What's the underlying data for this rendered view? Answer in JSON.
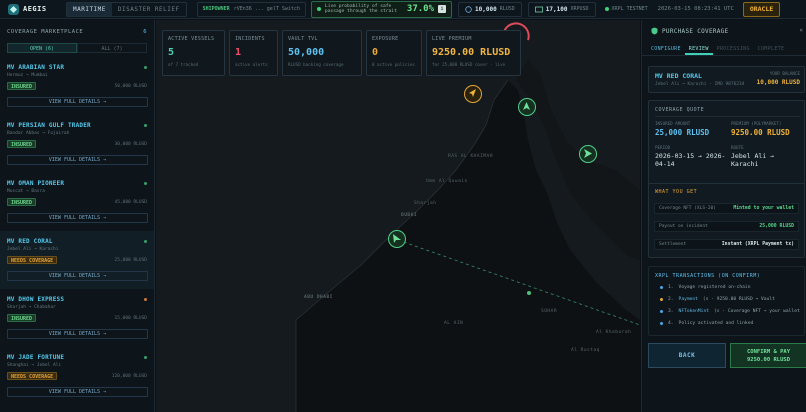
{
  "app": {
    "name": "AEGIS",
    "modes": [
      "MARITIME",
      "DISASTER RELIEF"
    ],
    "active_mode": "MARITIME"
  },
  "topbar": {
    "role_label": "SHIPOWNER",
    "role_detail": "rVEn36 ... gelT  Switch",
    "prob_text": "Live probability of safe passage through the strait",
    "prob_value": "37.0%",
    "prob_icon": "i",
    "rlusd_balance": "10,000",
    "rlusd_unit": "RLUSD",
    "xrp_balance": "17,100",
    "xrp_unit": "XRPUSD",
    "network": "XRPL TESTNET",
    "timestamp": "2026-03-15 08:23:41 UTC",
    "oracle_label": "ORACLE"
  },
  "left": {
    "title": "COVERAGE MARKETPLACE",
    "count": "6",
    "tabs": [
      {
        "label": "OPEN (6)"
      },
      {
        "label": "ALL (7)"
      }
    ],
    "vessels": [
      {
        "name": "MV ARABIAN STAR",
        "route": "Hormuz → Mumbai",
        "status": "INSURED",
        "amount": "50,000 RLUSD",
        "action": "VIEW FULL DETAILS →",
        "dot": "#3aa06a"
      },
      {
        "name": "MV PERSIAN GULF TRADER",
        "route": "Bandar Abbas → Fujairah",
        "status": "INSURED",
        "amount": "30,000 RLUSD",
        "action": "VIEW FULL DETAILS →",
        "dot": "#3aa06a"
      },
      {
        "name": "MV OMAN PIONEER",
        "route": "Muscat → Basra",
        "status": "INSURED",
        "amount": "45,000 RLUSD",
        "action": "VIEW FULL DETAILS →",
        "dot": "#3aa06a"
      },
      {
        "name": "MV RED CORAL",
        "route": "Jebel Ali → Karachi",
        "status": "NEEDS COVERAGE",
        "amount": "25,000 RLUSD",
        "action": "VIEW FULL DETAILS →",
        "dot": "#3aa06a"
      },
      {
        "name": "MV DHOW EXPRESS",
        "route": "Sharjah → Chabahar",
        "status": "INSURED",
        "amount": "15,000 RLUSD",
        "action": "VIEW FULL DETAILS →",
        "dot": "#d07a3a"
      },
      {
        "name": "MV JADE FORTUNE",
        "route": "Shanghai → Jebel Ali",
        "status": "NEEDS COVERAGE",
        "amount": "120,000 RLUSD",
        "action": "VIEW FULL DETAILS →",
        "dot": "#3aa06a"
      }
    ]
  },
  "stats": [
    {
      "label": "ACTIVE VESSELS",
      "value": "5",
      "sub": "of 7 tracked",
      "color": "#4fd0b0"
    },
    {
      "label": "INCIDENTS",
      "value": "1",
      "sub": "active alerts",
      "color": "#f0506e"
    },
    {
      "label": "VAULT TVL",
      "value": "50,000",
      "sub": "RLUSD backing coverage",
      "color": "#5fc2f0"
    },
    {
      "label": "EXPOSURE",
      "value": "0",
      "sub": "0 active policies",
      "color": "#e8a93a"
    },
    {
      "label": "LIVE PREMIUM",
      "value": "9250.00 RLUSD",
      "sub": "for 25,000 RLUSD cover · live",
      "color": "#f2b544"
    }
  ],
  "map_labels": [
    "RAS AL KHAIMAH",
    "Umm Al Quwain",
    "Sharjah",
    "DUBAI",
    "ABU DHABI",
    "AL AIN",
    "SOHAR",
    "Al Khaburah",
    "Al Rustaq"
  ],
  "right": {
    "title": "PURCHASE COVERAGE",
    "steps": [
      {
        "label": "CONFIGURE"
      },
      {
        "label": "REVIEW"
      },
      {
        "label": "PROCESSING"
      },
      {
        "label": "COMPLETE"
      }
    ],
    "active_step": "REVIEW",
    "vessel": {
      "name": "MV RED CORAL",
      "detail": "Jebel Ali → Karachi · IMO 9876234",
      "balance_label": "YOUR BALANCE",
      "balance": "10,000 RLUSD"
    },
    "quote": {
      "title": "COVERAGE QUOTE",
      "insured_label": "INSURED AMOUNT",
      "insured": "25,000 RLUSD",
      "premium_label": "PREMIUM (POLYMARKET)",
      "premium": "9250.00 RLUSD",
      "period_label": "PERIOD",
      "period": "2026-03-15 → 2026-04-14",
      "route_label": "ROUTE",
      "route": "Jebel Ali → Karachi"
    },
    "get": {
      "title": "WHAT YOU GET",
      "rows": [
        {
          "k": "Coverage NFT (XLS-20)",
          "v": "Minted to your wallet"
        },
        {
          "k": "Payout on incident",
          "v": "25,000 RLUSD"
        },
        {
          "k": "Settlement",
          "v": "Instant (XRPL Payment tx)"
        }
      ]
    },
    "xrpl": {
      "title": "XRPL TRANSACTIONS (ON CONFIRM)",
      "items": [
        {
          "n": "1.",
          "type": "",
          "text": "Voyage registered on-chain",
          "color": "#4aa8e8"
        },
        {
          "n": "2.",
          "type": "Payment",
          "text": "(s · 9250.00 RLUSD → Vault",
          "color": "#e8a93a"
        },
        {
          "n": "3.",
          "type": "NFTokenMint",
          "text": "(s · Coverage NFT → your wallet",
          "color": "#4aa8e8"
        },
        {
          "n": "4.",
          "type": "",
          "text": "Policy activated and linked",
          "color": "#4aa8e8"
        }
      ]
    },
    "back_label": "BACK",
    "confirm_label": "CONFIRM & PAY",
    "confirm_amount": "9250.00 RLUSD"
  }
}
